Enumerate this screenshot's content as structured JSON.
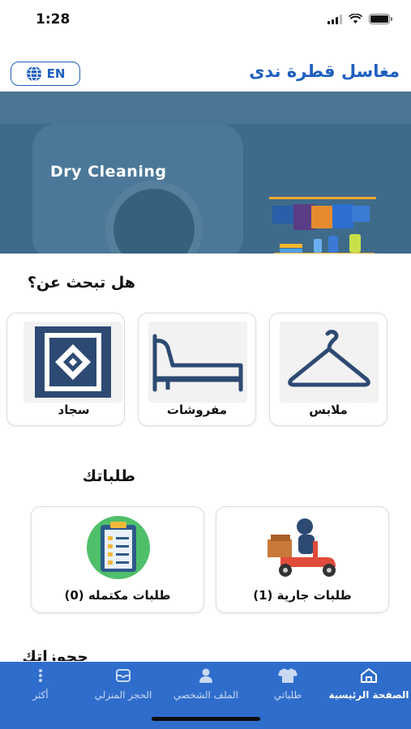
{
  "status_bar": {
    "time": "1:28"
  },
  "header": {
    "title": "مغاسل قطرة ندى",
    "language_button": "EN"
  },
  "banner": {
    "text": "Dry Cleaning"
  },
  "categories_section": {
    "title": "هل تبحث عن؟",
    "items": [
      {
        "label": "ملابس",
        "icon": "hanger-icon"
      },
      {
        "label": "مفروشات",
        "icon": "bed-icon"
      },
      {
        "label": "سجاد",
        "icon": "carpet-icon"
      }
    ]
  },
  "orders_section": {
    "title": "طلباتك",
    "items": [
      {
        "label": "طلبات جارية  (1)",
        "icon": "delivery-scooter-icon"
      },
      {
        "label": "طلبات مكتمله (0)",
        "icon": "checklist-icon"
      }
    ]
  },
  "next_section_partial_title": "حجوزاتك",
  "bottom_nav": {
    "items": [
      {
        "label": "الصفحة الرئيسية",
        "icon": "home-icon",
        "active": true
      },
      {
        "label": "طلباتي",
        "icon": "shirt-icon",
        "active": false
      },
      {
        "label": "الملف الشخصي",
        "icon": "person-icon",
        "active": false
      },
      {
        "label": "الحجز المنزلي",
        "icon": "box-icon",
        "active": false
      },
      {
        "label": "أكثر",
        "icon": "more-icon",
        "active": false
      }
    ]
  },
  "colors": {
    "primary": "#1f5fbf",
    "nav_background": "#2f6dcc",
    "banner": "#3f6b8b"
  }
}
